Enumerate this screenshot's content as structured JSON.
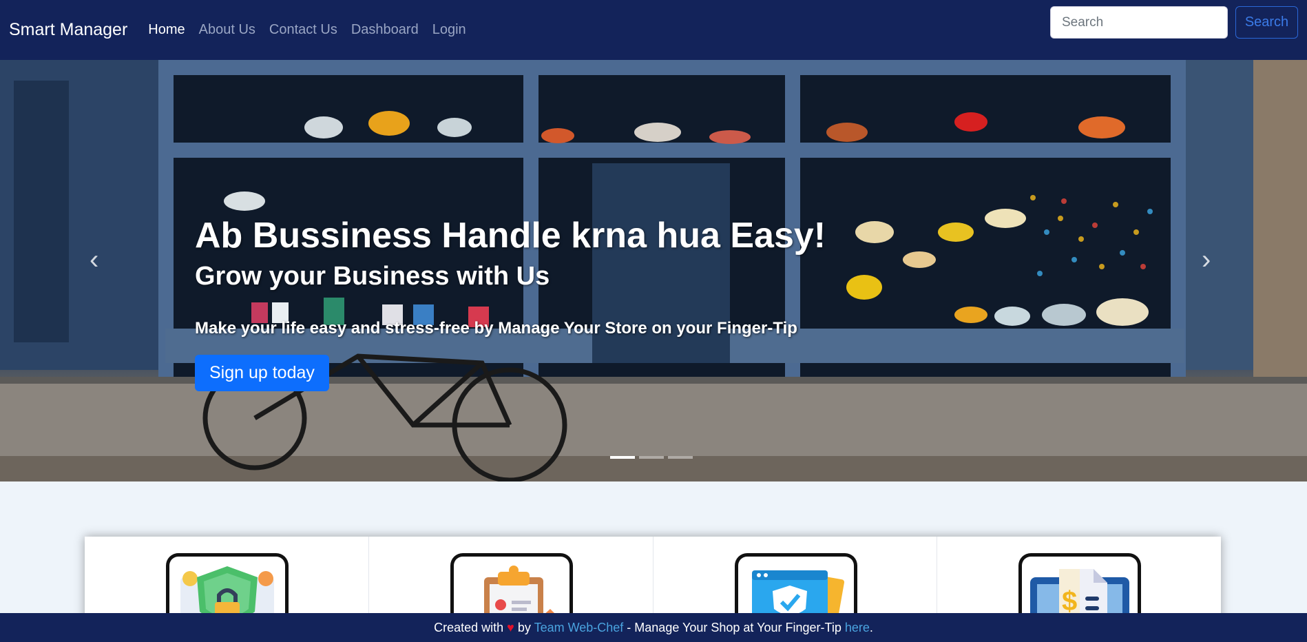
{
  "navbar": {
    "brand": "Smart Manager",
    "links": [
      {
        "label": "Home",
        "active": true
      },
      {
        "label": "About Us"
      },
      {
        "label": "Contact Us"
      },
      {
        "label": "Dashboard"
      },
      {
        "label": "Login"
      }
    ],
    "search_placeholder": "Search",
    "search_button": "Search"
  },
  "hero": {
    "title": "Ab Bussiness Handle krna hua Easy!",
    "subtitle": "Grow your Business with Us",
    "text": "Make your life easy and stress-free by Manage Your Store on your Finger-Tip",
    "cta": "Sign up today",
    "prev_icon": "chevron-left-icon",
    "next_icon": "chevron-right-icon",
    "slide_count": 3,
    "active_slide": 1
  },
  "cards": [
    {
      "icon": "security-shield-lock-icon"
    },
    {
      "icon": "clipboard-report-icon"
    },
    {
      "icon": "secure-browser-shield-icon"
    },
    {
      "icon": "invoice-dollar-icon"
    }
  ],
  "footer": {
    "prefix": "Created with",
    "heart": "♥",
    "by": "by",
    "team": "Team Web-Chef",
    "middle": "- Manage Your Shop at Your Finger-Tip",
    "link": "here",
    "suffix": "."
  },
  "colors": {
    "navbar_bg": "#13235a",
    "primary": "#0d6efd",
    "link": "#4aa3df"
  }
}
